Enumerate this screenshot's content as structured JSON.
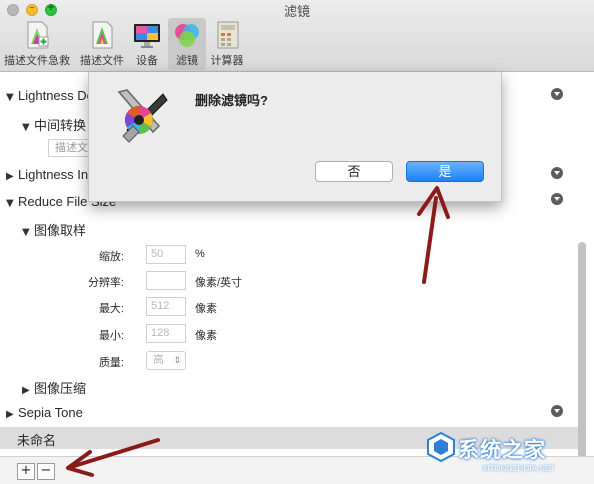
{
  "window": {
    "title": "滤镜"
  },
  "toolbar": {
    "items": [
      {
        "label": "描述文件急救",
        "icon": "colorsync-firstaid-icon"
      },
      {
        "label": "描述文件",
        "icon": "profile-icon"
      },
      {
        "label": "设备",
        "icon": "display-icon"
      },
      {
        "label": "滤镜",
        "icon": "filters-icon",
        "selected": true
      },
      {
        "label": "计算器",
        "icon": "calculator-icon"
      }
    ]
  },
  "dialog": {
    "message": "删除滤镜吗?",
    "cancel_label": "否",
    "confirm_label": "是",
    "icon": "colorsync-utility-icon"
  },
  "filters": {
    "lightness_decrease": "Lightness De",
    "intermediate_transform": "中间转换",
    "description_field": "描述文",
    "lightness_increase": "Lightness In",
    "reduce_file_size": "Reduce File Size",
    "image_sampling": "图像取样",
    "scale_label": "缩放:",
    "scale_value": "50",
    "scale_unit": "%",
    "resolution_label": "分辨率:",
    "resolution_value": "",
    "resolution_unit": "像素/英寸",
    "max_label": "最大:",
    "max_value": "512",
    "max_unit": "像素",
    "min_label": "最小:",
    "min_value": "128",
    "min_unit": "像素",
    "quality_label": "质量:",
    "quality_value": "高",
    "image_compression": "图像压缩",
    "sepia_tone": "Sepia Tone",
    "untitled": "未命名"
  },
  "bottom_bar": {
    "add_label": "+",
    "remove_label": "−"
  },
  "watermark": {
    "text": "系统之家",
    "sub": "XITONGZHIJIA.NET"
  },
  "colors": {
    "accent": "#1a82fb",
    "arrow": "#8b1a1a"
  }
}
